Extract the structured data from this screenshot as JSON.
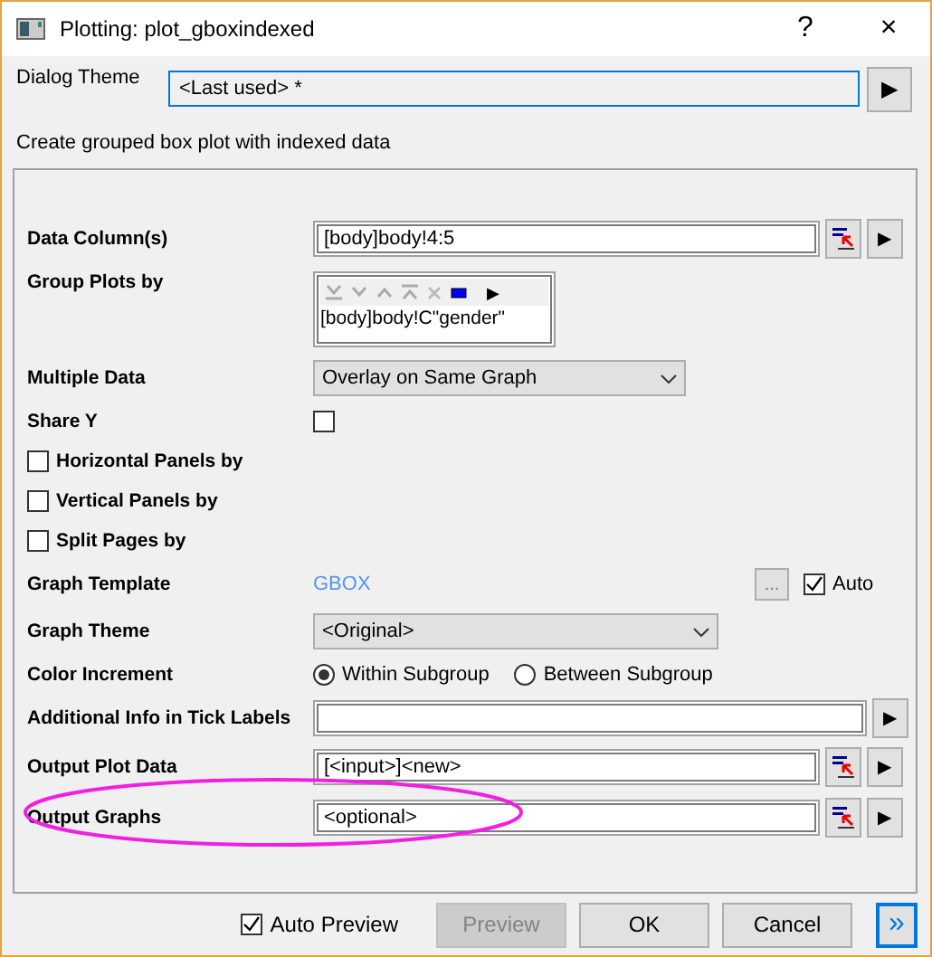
{
  "window": {
    "title": "Plotting: plot_gboxindexed",
    "help": "?",
    "close": "×"
  },
  "theme": {
    "label": "Dialog Theme",
    "value": "<Last used> *",
    "arrow": "▶"
  },
  "description": "Create grouped box plot with indexed data",
  "rows": [
    {
      "kind": "field",
      "label": "Data Column(s)",
      "value": "[body]body!4:5",
      "browse": true,
      "arrow": "▶",
      "highlighted": false
    },
    {
      "kind": "group",
      "label": "Group Plots by",
      "value": "[body]body!C\"gender\"",
      "arrow": "▶"
    },
    {
      "kind": "select",
      "label": "Multiple Data",
      "value": "Overlay on Same Graph"
    },
    {
      "kind": "check",
      "label": "Share Y",
      "checked": false
    },
    {
      "kind": "panel_check",
      "label": "Horizontal Panels by",
      "checked": false
    },
    {
      "kind": "panel_check",
      "label": "Vertical Panels by",
      "checked": false
    },
    {
      "kind": "panel_check",
      "label": "Split Pages by",
      "checked": false
    },
    {
      "kind": "template",
      "label": "Graph Template",
      "value": "GBOX",
      "button": "...",
      "auto": {
        "label": "Auto",
        "checked": true
      }
    },
    {
      "kind": "select",
      "label": "Graph Theme",
      "value": "<Original>"
    },
    {
      "kind": "radio",
      "label": "Color Increment",
      "options": [
        {
          "label": "Within Subgroup",
          "selected": true
        },
        {
          "label": "Between Subgroup",
          "selected": false
        }
      ]
    },
    {
      "kind": "field",
      "label": "Additional Info in Tick Labels",
      "value": "",
      "browse": false,
      "arrow": "▶",
      "highlighted": false
    },
    {
      "kind": "field",
      "label": "Output Plot Data",
      "value": "[<input>]<new>",
      "browse": true,
      "arrow": "▶",
      "highlighted": false
    },
    {
      "kind": "field",
      "label": "Output Graphs",
      "value": "<optional>",
      "browse": true,
      "arrow": "▶",
      "highlighted": true
    }
  ],
  "footer": {
    "auto_preview": {
      "label": "Auto Preview",
      "checked": true
    },
    "buttons": [
      {
        "label": "Preview",
        "disabled": true
      },
      {
        "label": "OK",
        "disabled": false
      },
      {
        "label": "Cancel",
        "disabled": false
      }
    ],
    "expand": "»"
  }
}
